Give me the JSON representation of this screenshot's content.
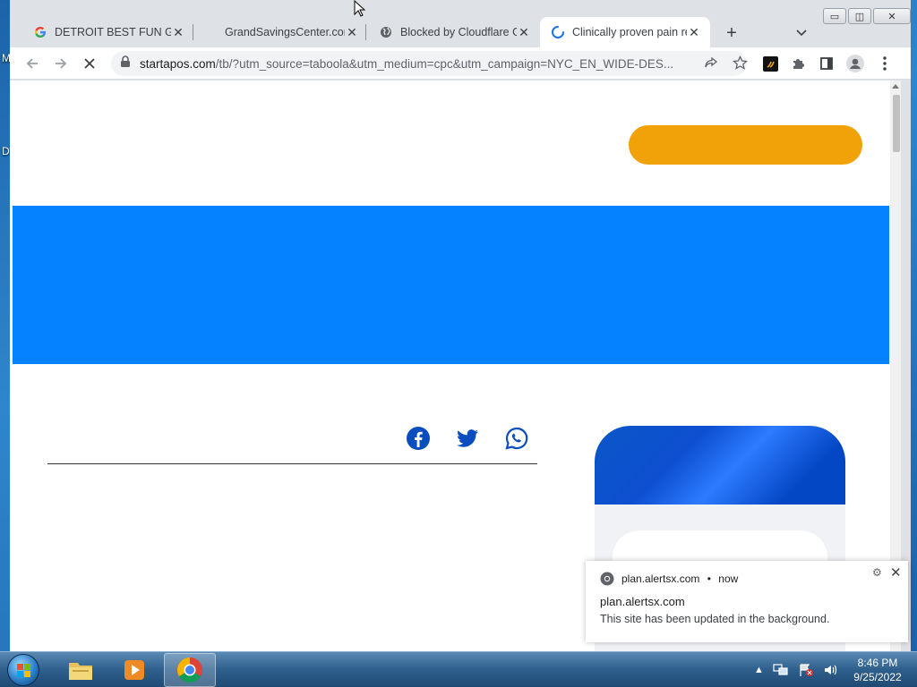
{
  "browser": {
    "tabs": [
      {
        "title": "DETROIT BEST FUN GAM",
        "favicon": "google-g-icon"
      },
      {
        "title": "GrandSavingsCenter.com",
        "favicon": "none"
      },
      {
        "title": "Blocked by Cloudflare G",
        "favicon": "globe-icon"
      },
      {
        "title": "Clinically proven pain re",
        "favicon": "loading-spinner-icon",
        "active": true
      }
    ],
    "url_host": "startapos.com",
    "url_path": "/tb/?utm_source=taboola&utm_medium=cpc&utm_campaign=NYC_EN_WIDE-DES...",
    "window_buttons": {
      "minimize": "▭",
      "maximize": "◫",
      "close": "✕"
    }
  },
  "page": {
    "cta_color": "#f1a208",
    "banner_color": "#0582ff",
    "share_icons": [
      "facebook-icon",
      "twitter-icon",
      "whatsapp-icon"
    ]
  },
  "notification": {
    "source": "plan.alertsx.com",
    "time": "now",
    "separator": "•",
    "title": "plan.alertsx.com",
    "body": "This site has been updated in the background."
  },
  "desktop": {
    "labels": [
      "M",
      "D"
    ]
  },
  "taskbar": {
    "time": "8:46 PM",
    "date": "9/25/2022"
  }
}
